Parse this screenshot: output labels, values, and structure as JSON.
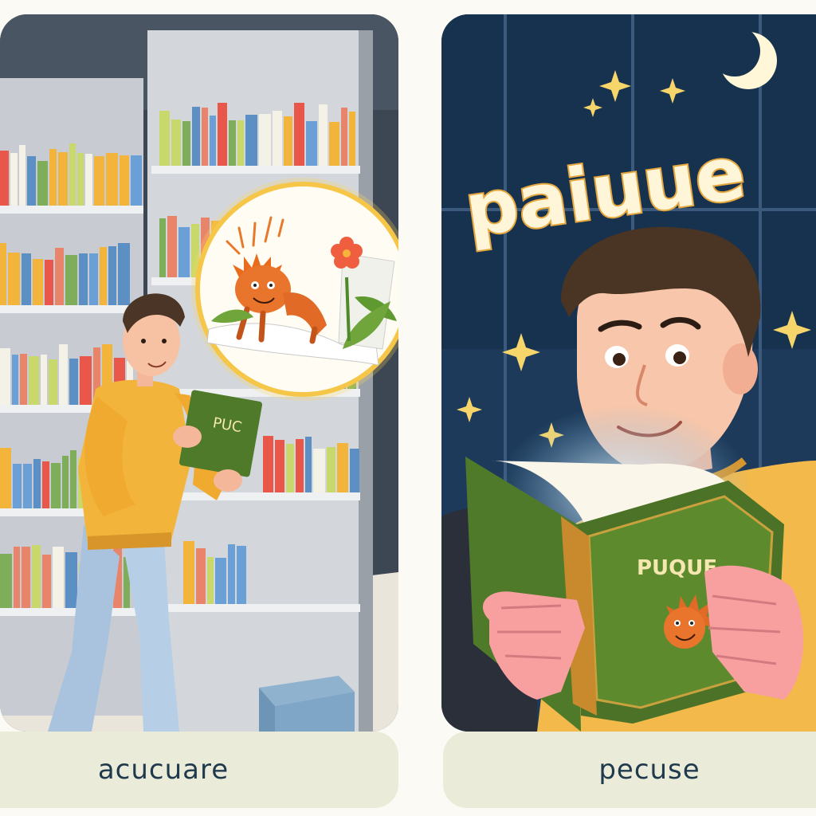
{
  "left_panel": {
    "caption": "acucuare",
    "book_cover_text": "PUC"
  },
  "right_panel": {
    "title": "paiuue",
    "book_cover_text": "PUQUE",
    "caption": "pecuse"
  },
  "colors": {
    "left_background": "#3d4754",
    "right_background": "#1d3a5a",
    "sweater": "#f2b43a",
    "book_green": "#4f7a2a",
    "caption_box": "#ebebd9",
    "caption_text": "#1f3a4d",
    "glow": "#ffd75a",
    "moon": "#fff7d8"
  },
  "icons": [
    "moon-icon",
    "sparkle-icon",
    "creature-illustration",
    "flower-illustration"
  ]
}
